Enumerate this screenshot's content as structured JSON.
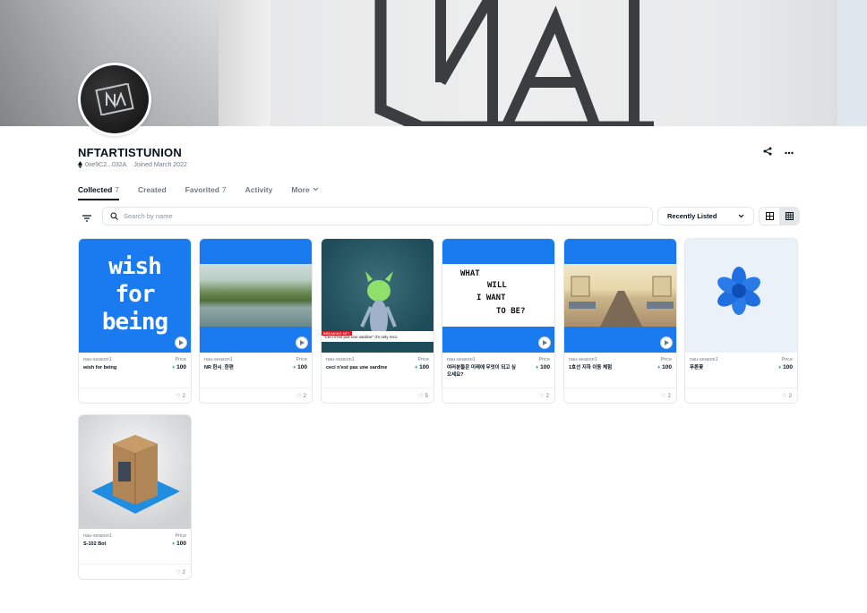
{
  "profile": {
    "name": "NFTARTISTUNION",
    "address": "0xe9C2...032A",
    "joined": "Joined March 2022"
  },
  "tabs": [
    {
      "label": "Collected",
      "count": "7"
    },
    {
      "label": "Created",
      "count": ""
    },
    {
      "label": "Favorited",
      "count": "7"
    },
    {
      "label": "Activity",
      "count": ""
    },
    {
      "label": "More",
      "count": ""
    }
  ],
  "search": {
    "placeholder": "Search by name"
  },
  "sort": {
    "value": "Recently Listed"
  },
  "cards": [
    {
      "collection": "nau-season1",
      "name": "wish for being",
      "price_label": "Price",
      "price": "100",
      "likes": "2",
      "art_text": [
        "wish",
        "for",
        "being"
      ]
    },
    {
      "collection": "nau-season1",
      "name": "NR 한시_한편",
      "price_label": "Price",
      "price": "100",
      "likes": "2"
    },
    {
      "collection": "nau-season1",
      "name": "ceci n'est pas une sardine",
      "price_label": "Price",
      "price": "100",
      "likes": "5",
      "caption_tag": "BREAKING NFT",
      "caption": "\"Ceci n'est pas une sardine\" It's only reco"
    },
    {
      "collection": "nau-season1",
      "name": "여러분들은 미래에 무엇이 되고 싶으세요?",
      "price_label": "Price",
      "price": "100",
      "likes": "2",
      "art_text": [
        "WHAT",
        "WILL",
        "I WANT",
        "TO BE?"
      ]
    },
    {
      "collection": "nau-season1",
      "name": "1호선 지하 이동 체험",
      "price_label": "Price",
      "price": "100",
      "likes": "2"
    },
    {
      "collection": "nau-season1",
      "name": "푸른꽃",
      "price_label": "Price",
      "price": "100",
      "likes": "2"
    },
    {
      "collection": "nau-season1",
      "name": "S-102 Bot",
      "price_label": "Price",
      "price": "100",
      "likes": "2"
    }
  ],
  "icons": {
    "share": "share-icon",
    "more": "more-icon",
    "eth": "eth-icon",
    "heart": "heart-icon"
  }
}
